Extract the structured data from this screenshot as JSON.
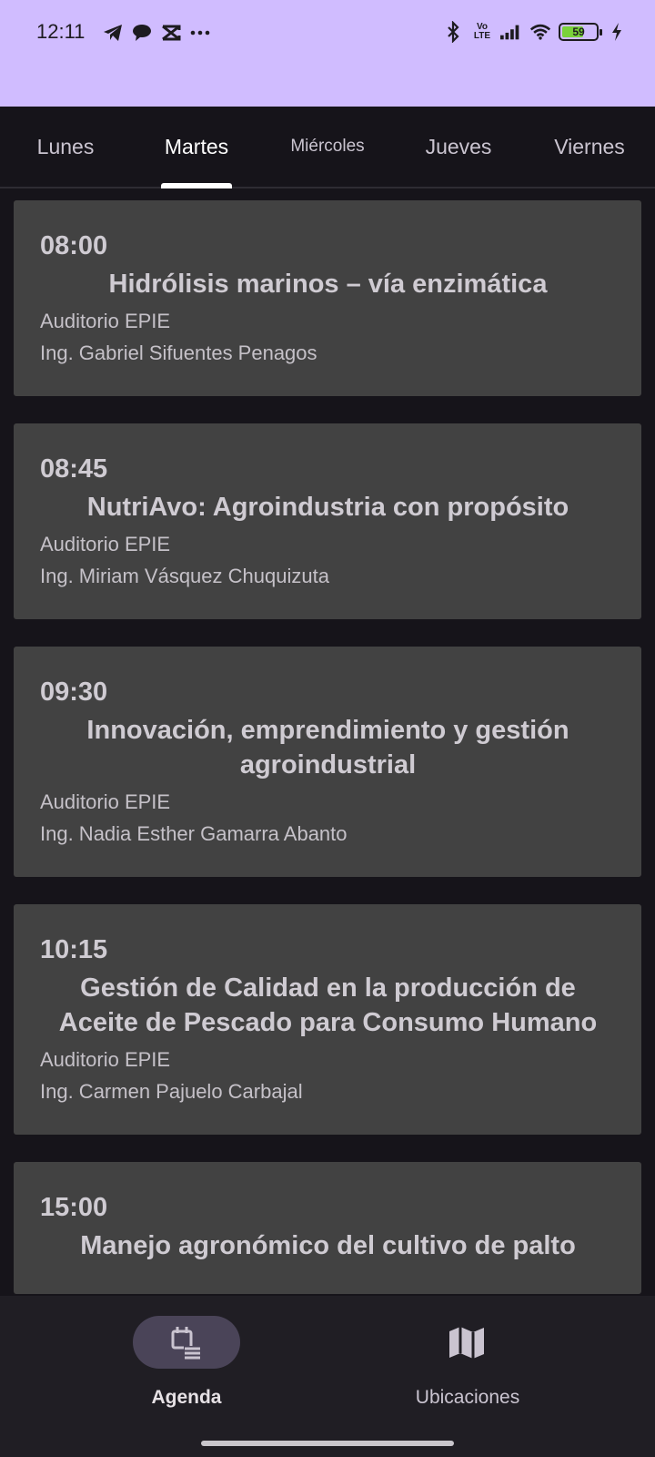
{
  "status_bar": {
    "time": "12:11",
    "left_icons": [
      "telegram-icon",
      "chat-bubble-icon",
      "capcut-icon",
      "more-icon"
    ],
    "volte_label": "Vo\nLTE",
    "battery_level": "59"
  },
  "tabs": [
    {
      "label": "Lunes",
      "active": false
    },
    {
      "label": "Martes",
      "active": true
    },
    {
      "label": "Miércoles",
      "active": false
    },
    {
      "label": "Jueves",
      "active": false
    },
    {
      "label": "Viernes",
      "active": false
    }
  ],
  "sessions": [
    {
      "time": "08:00",
      "title": "Hidrólisis marinos – vía enzimática",
      "place": "Auditorio EPIE",
      "speaker": "Ing. Gabriel Sifuentes Penagos"
    },
    {
      "time": "08:45",
      "title": "NutriAvo: Agroindustria con propósito",
      "place": "Auditorio EPIE",
      "speaker": "Ing. Miriam Vásquez Chuquizuta"
    },
    {
      "time": "09:30",
      "title": "Innovación, emprendimiento y gestión agroindustrial",
      "place": "Auditorio EPIE",
      "speaker": "Ing. Nadia Esther Gamarra Abanto"
    },
    {
      "time": "10:15",
      "title": "Gestión de Calidad en la producción de Aceite de Pescado para Consumo Humano",
      "place": "Auditorio EPIE",
      "speaker": "Ing. Carmen Pajuelo Carbajal"
    },
    {
      "time": "15:00",
      "title": "Manejo agronómico del cultivo de palto",
      "place": "",
      "speaker": ""
    }
  ],
  "bottom_nav": {
    "agenda_label": "Agenda",
    "ubicaciones_label": "Ubicaciones"
  },
  "colors": {
    "status_bar_bg": "#d0bcff",
    "background": "#16141a",
    "card_bg": "#424242",
    "nav_active_pill": "#4a4458"
  }
}
